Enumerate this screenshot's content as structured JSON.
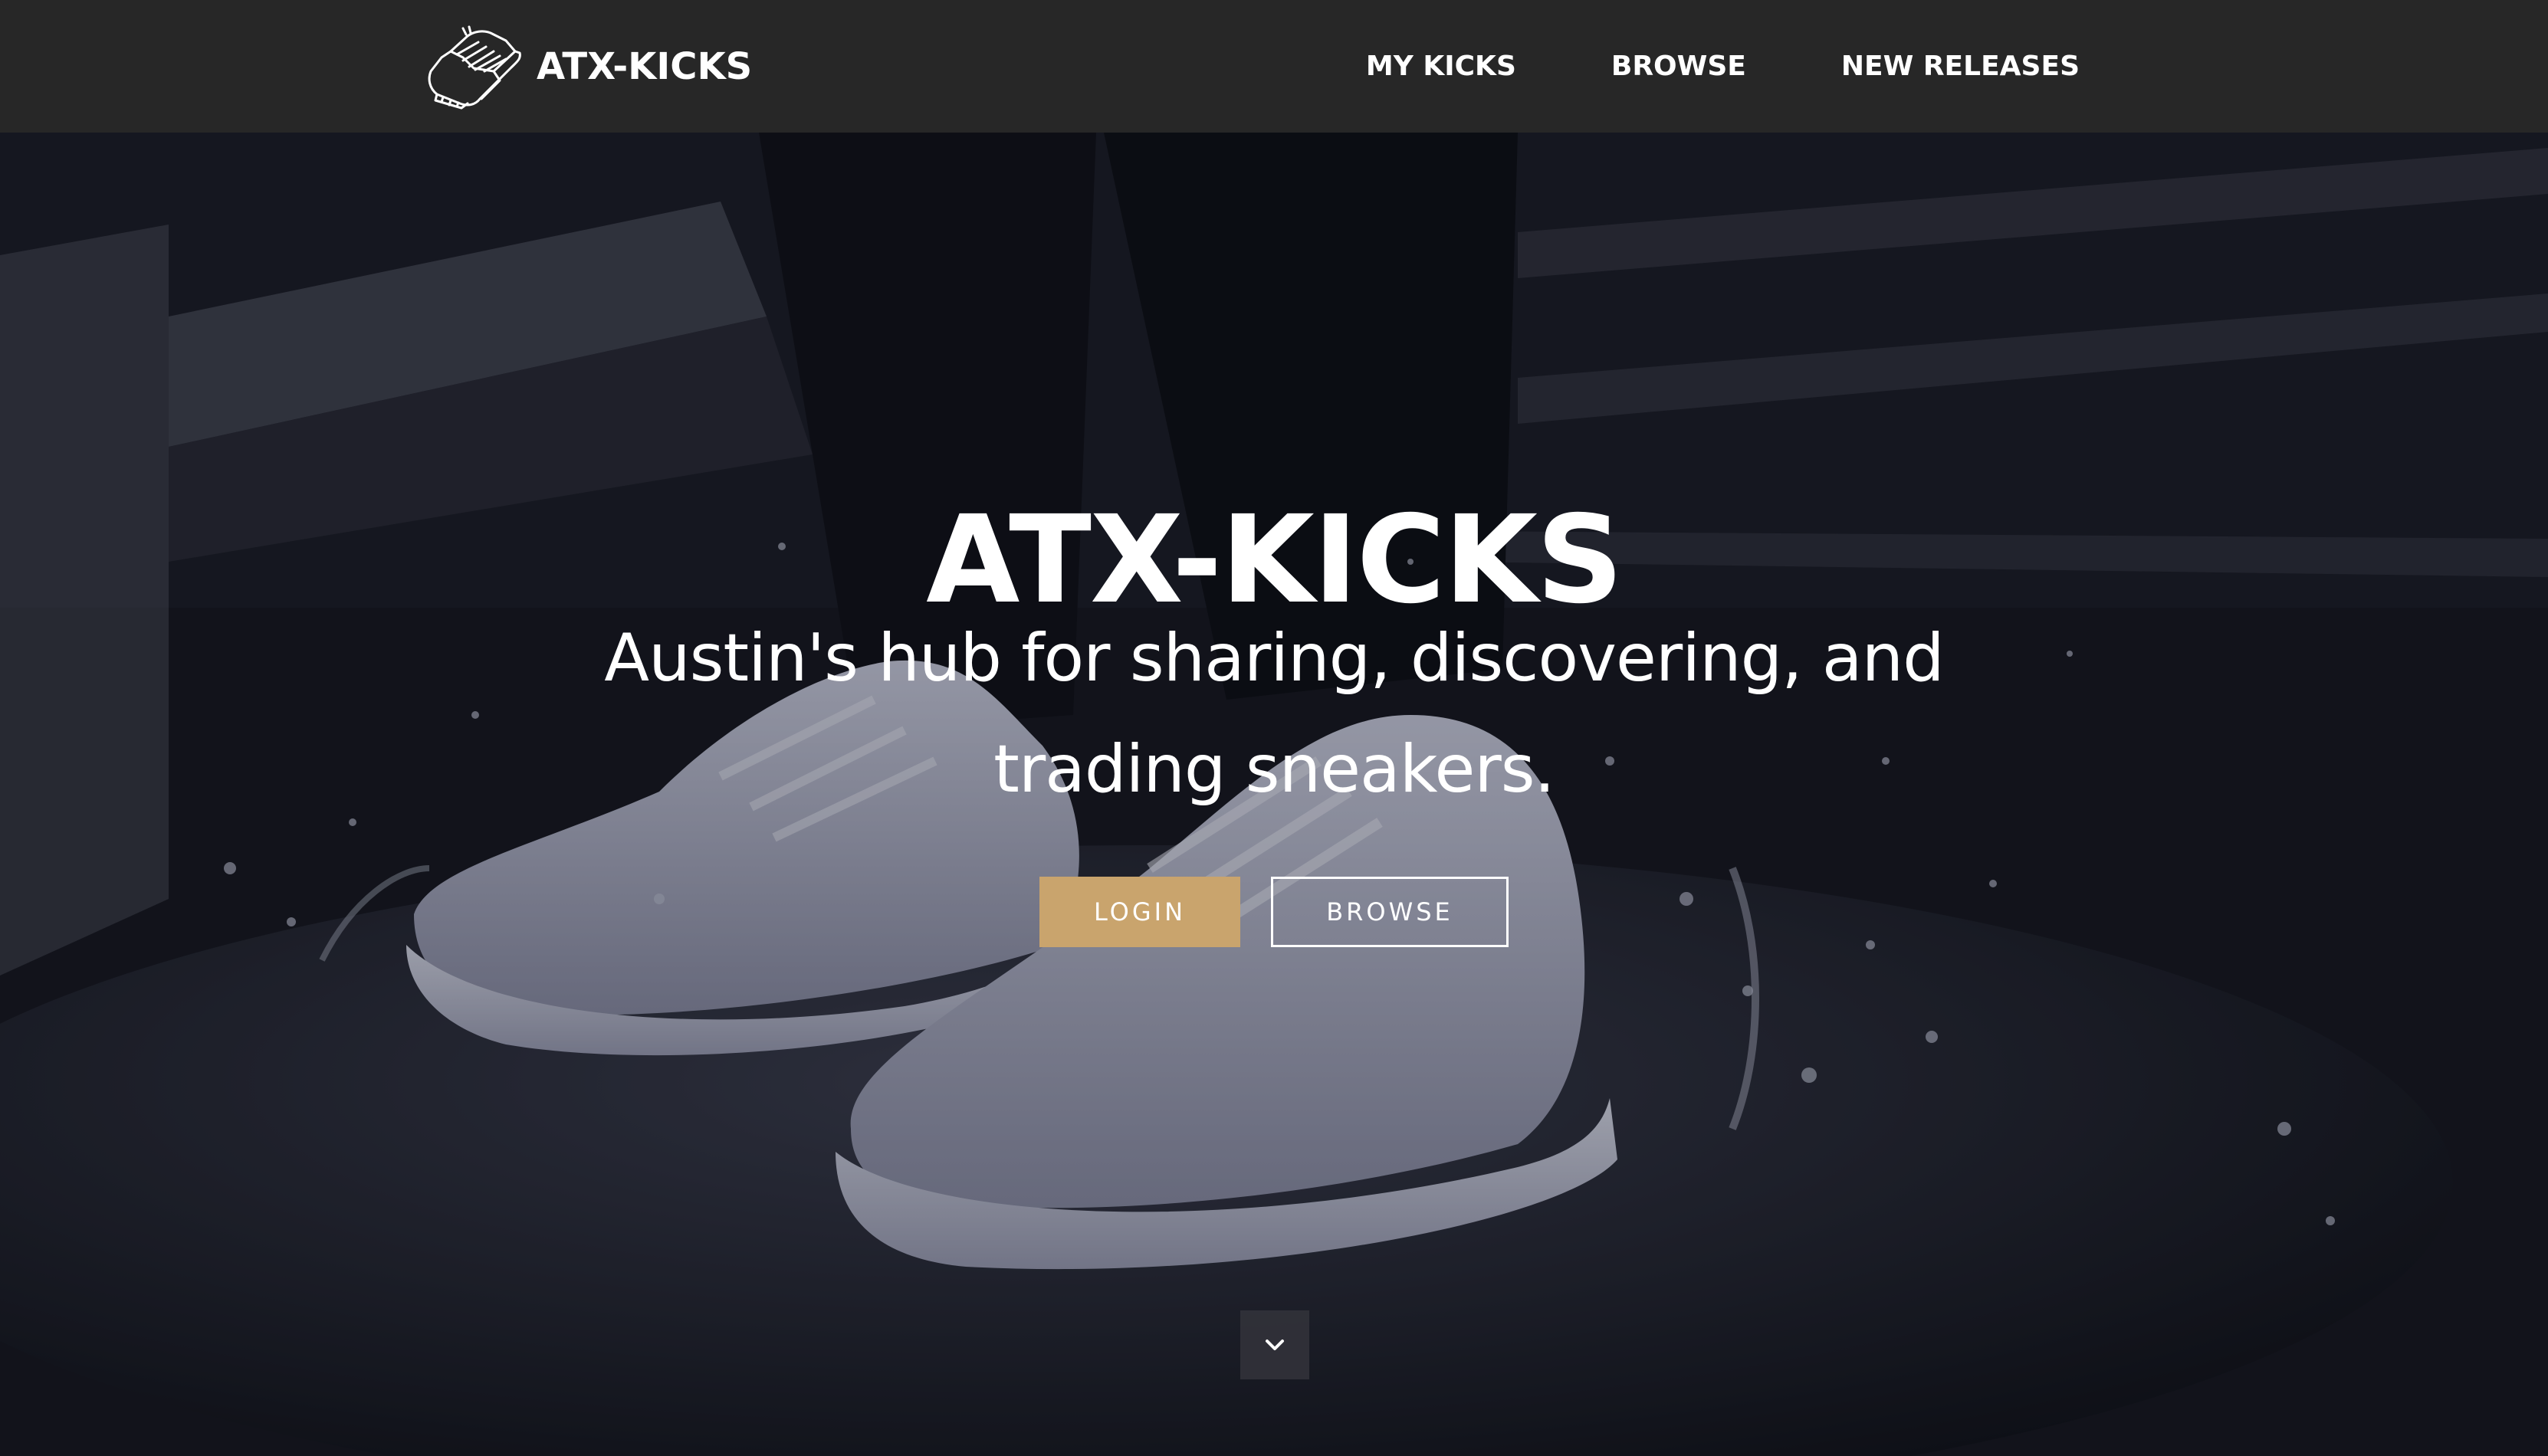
{
  "navbar": {
    "brand_name": "ATX-KICKS",
    "brand_icon": "sneaker-logo-icon",
    "links": [
      {
        "label": "MY KICKS"
      },
      {
        "label": "BROWSE"
      },
      {
        "label": "NEW RELEASES"
      }
    ]
  },
  "hero": {
    "title": "ATX-KICKS",
    "subtitle": "Austin's hub for sharing, discovering, and trading sneakers.",
    "background_image": "sneakers-splashing-in-puddle-photo",
    "buttons": {
      "login_label": "LOGIN",
      "browse_label": "BROWSE"
    },
    "scroll_icon": "chevron-down-icon"
  },
  "colors": {
    "navbar_bg": "#272727",
    "accent_gold": "#c9a46d",
    "text": "#ffffff"
  }
}
